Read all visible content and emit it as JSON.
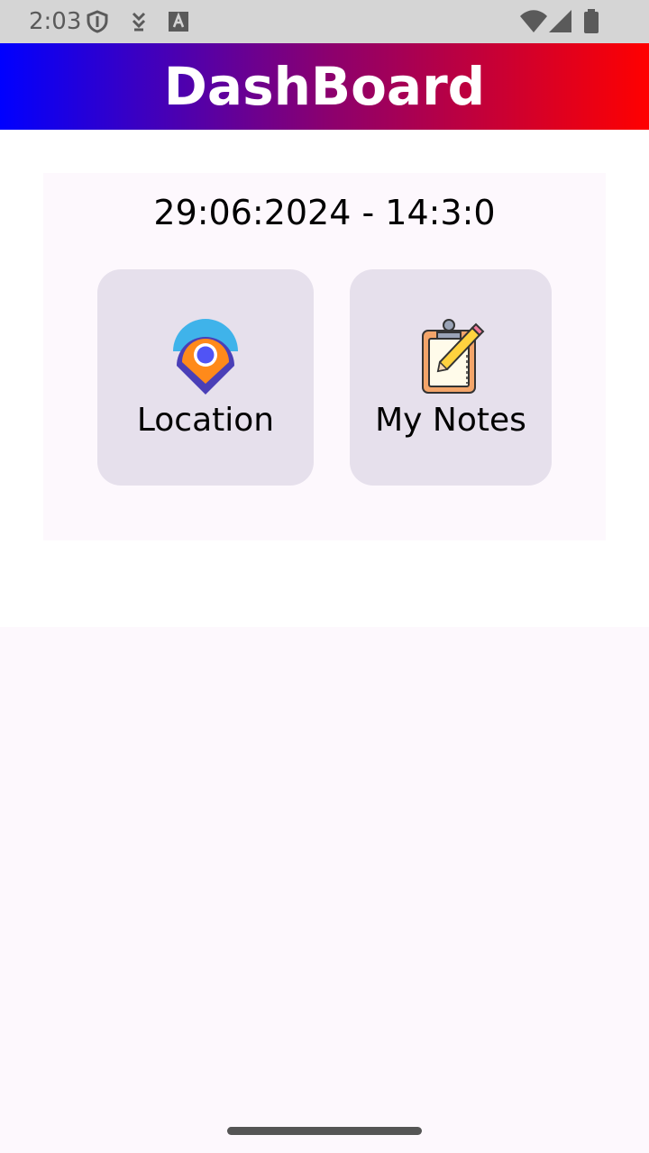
{
  "status_bar": {
    "time": "2:03",
    "icons": [
      "shield-icon",
      "download-icon",
      "keyboard-a-icon",
      "wifi-icon",
      "signal-icon",
      "battery-icon"
    ]
  },
  "app_bar": {
    "title": "DashBoard",
    "gradient_colors": [
      "#0000ff",
      "#ff0000"
    ]
  },
  "dashboard": {
    "datetime": "29:06:2024 - 14:3:0",
    "tiles": [
      {
        "label": "Location",
        "icon": "location-pin-icon"
      },
      {
        "label": "My Notes",
        "icon": "notes-clipboard-icon"
      }
    ]
  },
  "colors": {
    "tile_background": "#e6e0ec",
    "page_background": "#fdf8fd"
  }
}
